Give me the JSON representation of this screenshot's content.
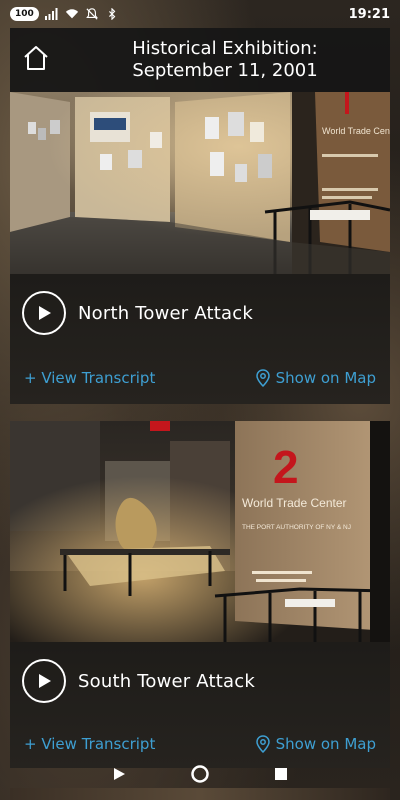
{
  "status_bar": {
    "battery": "100",
    "time": "19:21",
    "icons": [
      "signal-icon",
      "wifi-icon",
      "mute-icon",
      "bluetooth-icon"
    ]
  },
  "header": {
    "title_line1": "Historical Exhibition:",
    "title_line2": "September 11, 2001",
    "home_icon": "home-icon"
  },
  "cards": [
    {
      "title": "North Tower Attack",
      "transcript_label": "+ View Transcript",
      "map_label": "Show on Map",
      "image_sign_text": "World Trade Center"
    },
    {
      "title": "South Tower Attack",
      "transcript_label": "+ View Transcript",
      "map_label": "Show on Map",
      "image_sign_number": "2",
      "image_sign_text": "World Trade Center",
      "image_sign_sub": "THE PORT AUTHORITY OF NY & NJ"
    }
  ],
  "nav_bar": {
    "back_icon": "back-triangle-icon",
    "home_icon": "home-circle-icon",
    "recents_icon": "recents-square-icon"
  },
  "colors": {
    "accent_link": "#3e9fd2",
    "sign_red": "#c4161c",
    "header_bg": "#161616"
  }
}
